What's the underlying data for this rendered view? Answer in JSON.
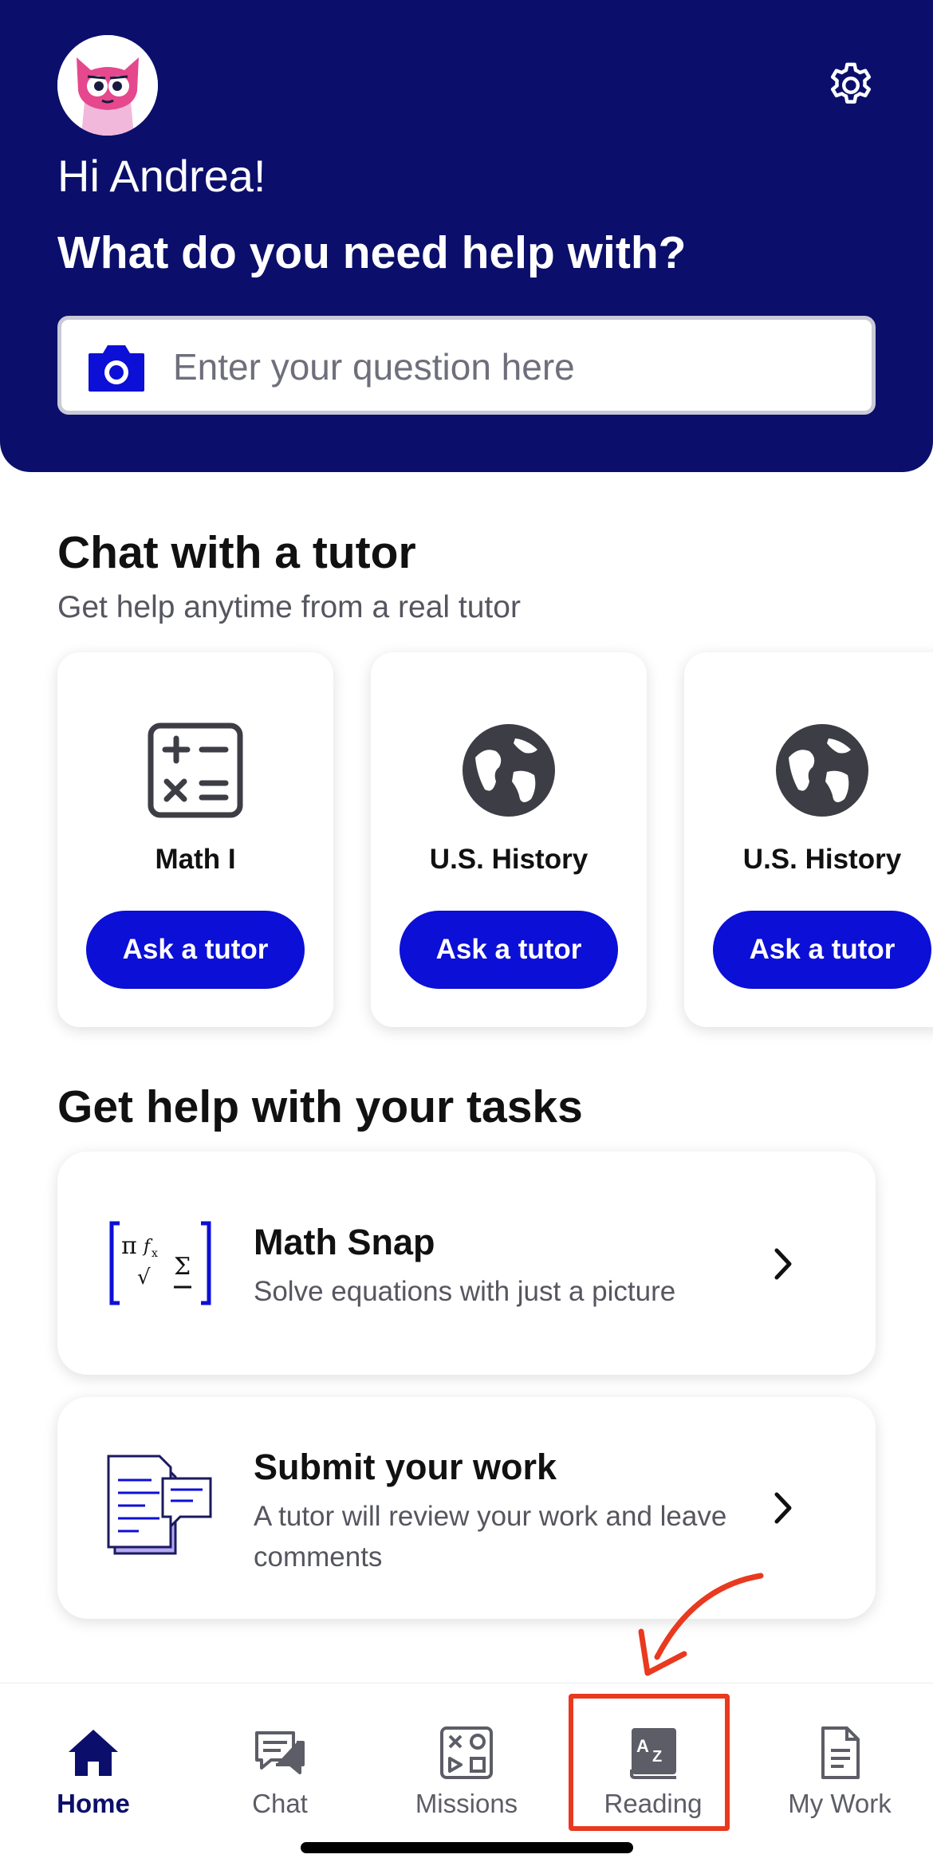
{
  "header": {
    "greeting": "Hi Andrea!",
    "headline": "What do you need help with?",
    "search_placeholder": "Enter your question here",
    "settings_icon": "gear-icon",
    "camera_icon": "camera-icon",
    "avatar": "monster-avatar"
  },
  "tutor_section": {
    "title": "Chat with a tutor",
    "subtitle": "Get help anytime from a real tutor",
    "cards": [
      {
        "subject": "Math I",
        "icon": "calculator-icon",
        "button": "Ask a tutor"
      },
      {
        "subject": "U.S. History",
        "icon": "globe-icon",
        "button": "Ask a tutor"
      },
      {
        "subject": "U.S. History",
        "icon": "globe-icon",
        "button": "Ask a tutor"
      }
    ]
  },
  "tasks_section": {
    "title": "Get help with your tasks",
    "items": [
      {
        "title": "Math Snap",
        "description": "Solve equations with just a picture",
        "icon": "math-formula-icon"
      },
      {
        "title": "Submit your work",
        "description": "A tutor will review your work and leave comments",
        "icon": "documents-icon"
      }
    ]
  },
  "bottom_nav": {
    "items": [
      {
        "label": "Home",
        "icon": "home-icon",
        "active": true
      },
      {
        "label": "Chat",
        "icon": "chat-icon",
        "active": false
      },
      {
        "label": "Missions",
        "icon": "missions-icon",
        "active": false
      },
      {
        "label": "Reading",
        "icon": "reading-az-icon",
        "active": false
      },
      {
        "label": "My Work",
        "icon": "document-icon",
        "active": false
      }
    ]
  },
  "colors": {
    "header_bg": "#0b0f6b",
    "button_blue": "#0c0fd6",
    "annotation_red": "#e9391f"
  }
}
